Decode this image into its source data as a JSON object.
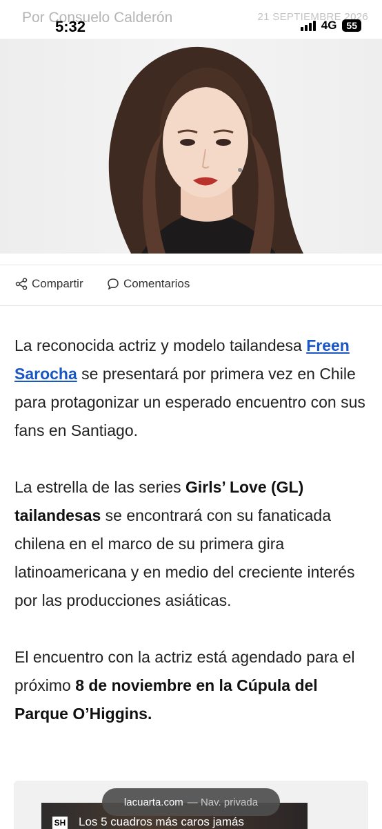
{
  "byline": {
    "author": "Por Consuelo Calderón",
    "date": "21 SEPTIEMBRE 2026"
  },
  "status_bar": {
    "time": "5:32",
    "network": "4G",
    "battery": "55"
  },
  "actions": {
    "share": "Compartir",
    "comments": "Comentarios"
  },
  "article": {
    "p1_start": "La reconocida actriz y modelo tailandesa ",
    "p1_link": "Freen Sarocha",
    "p1_end": " se presentará por primera vez en Chile para protagonizar un esperado encuentro con sus fans en Santiago.",
    "p2_start": "La estrella de las series ",
    "p2_bold": "Girls’ Love (GL) tailandesas",
    "p2_end": " se encontrará con su fanaticada chilena en el marco de su primera gira latinoamericana y en medio del creciente interés por las producciones asiáticas.",
    "p3_start": "El encuentro con la actriz está agendado para el próximo ",
    "p3_bold": "8 de noviembre en la Cúpula del Parque O’Higgins."
  },
  "related_card": {
    "logo": "SH",
    "title": "Los 5 cuadros más caros jamás"
  },
  "browser": {
    "domain": "lacuarta.com",
    "mode": "— Nav. privada"
  },
  "colors": {
    "link": "#1a56c4",
    "text": "#222222",
    "urlbar": "#4e4e4e"
  }
}
